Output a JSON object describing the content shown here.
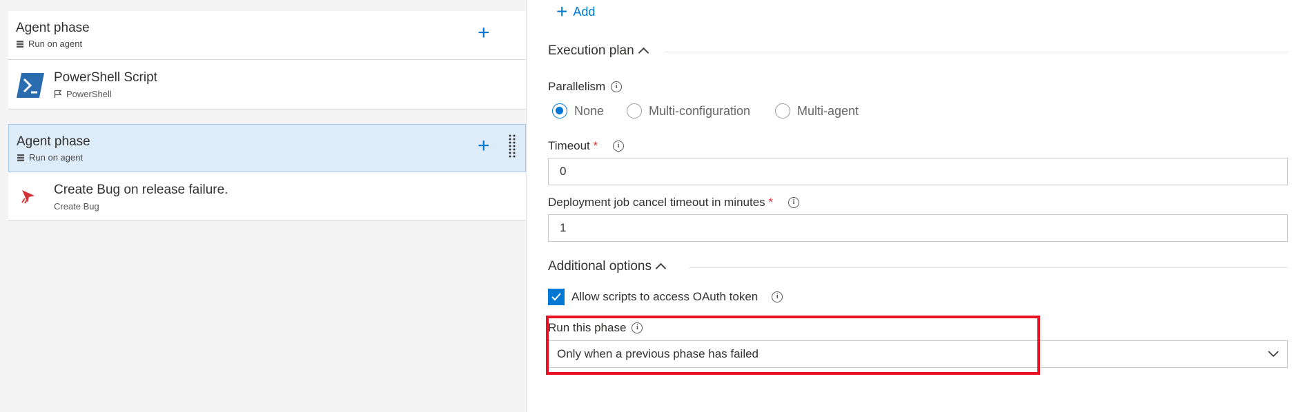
{
  "left": {
    "phase1": {
      "title": "Agent phase",
      "subtitle": "Run on agent"
    },
    "task1": {
      "title": "PowerShell Script",
      "subtitle": "PowerShell"
    },
    "phase2": {
      "title": "Agent phase",
      "subtitle": "Run on agent"
    },
    "task2": {
      "title": "Create Bug on release failure.",
      "subtitle": "Create Bug"
    }
  },
  "right": {
    "add_label": "Add",
    "execution_plan": {
      "heading": "Execution plan",
      "parallelism_label": "Parallelism",
      "options": [
        "None",
        "Multi-configuration",
        "Multi-agent"
      ],
      "selected": "None",
      "timeout_label": "Timeout",
      "timeout_value": "0",
      "cancel_timeout_label": "Deployment job cancel timeout in minutes",
      "cancel_timeout_value": "1",
      "required_mark": "*"
    },
    "additional_options": {
      "heading": "Additional options",
      "oauth_label": "Allow scripts to access OAuth token",
      "oauth_checked": true,
      "run_phase_label": "Run this phase",
      "run_phase_value": "Only when a previous phase has failed"
    }
  },
  "colors": {
    "accent": "#0078d4",
    "highlight_box": "#e81123",
    "selected_row": "#deecf9"
  }
}
